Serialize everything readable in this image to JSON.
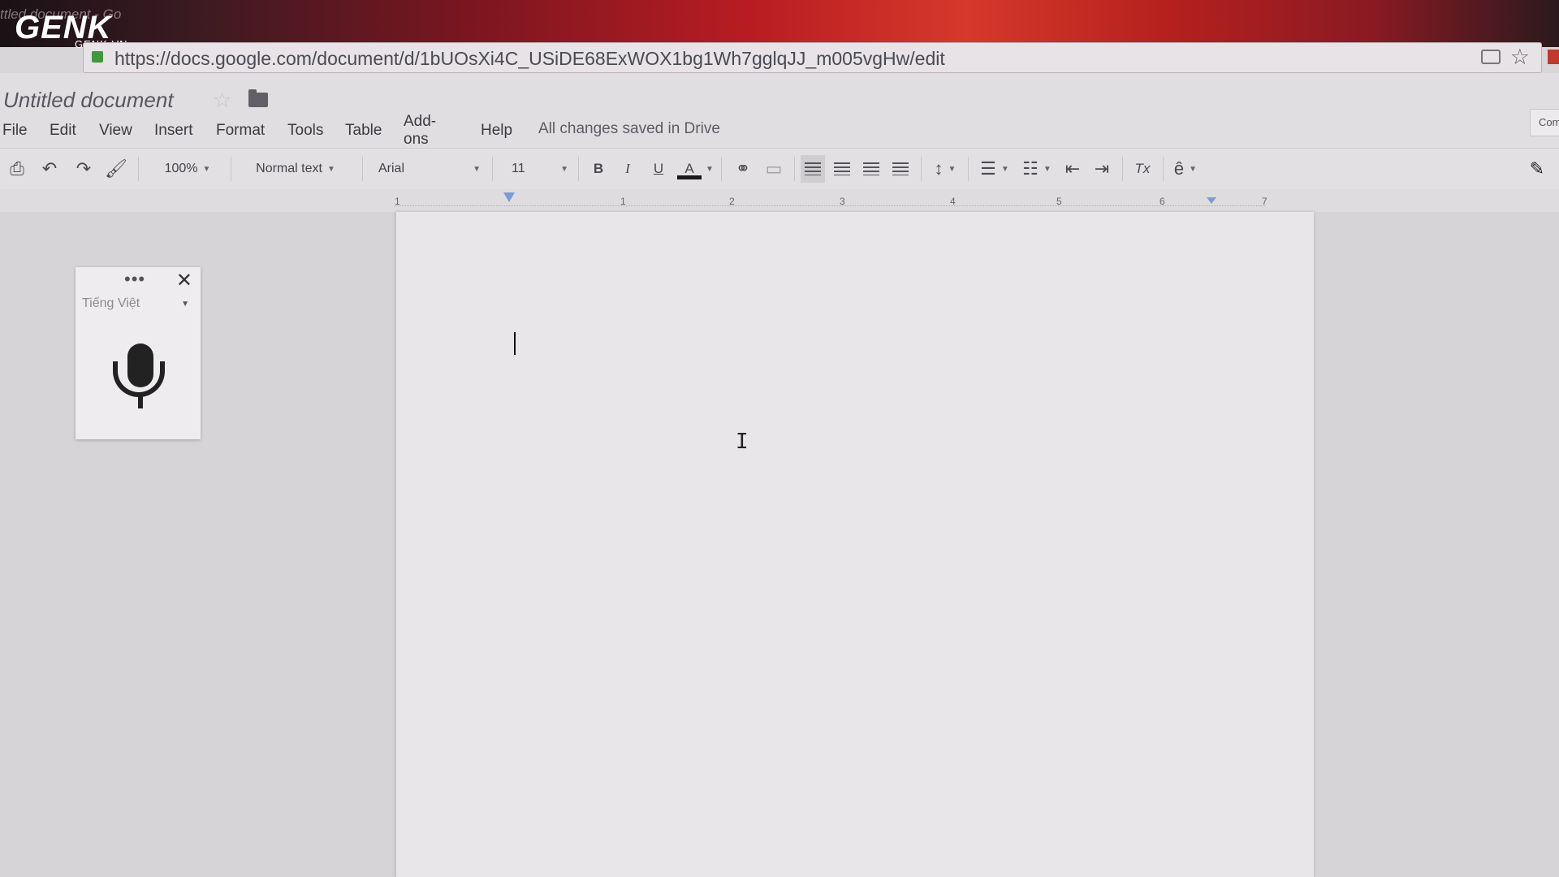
{
  "browser": {
    "tab_title": "ttled document - Go",
    "watermark": "GENK",
    "watermark_sub": "GENK.VN",
    "url": "https://docs.google.com/document/d/1bUOsXi4C_USiDE68ExWOX1bg1Wh7gglqJJ_m005vgHw/edit"
  },
  "doc": {
    "title": "Untitled document",
    "save_status": "All changes saved in Drive",
    "comments_label": "Com"
  },
  "menu": [
    "File",
    "Edit",
    "View",
    "Insert",
    "Format",
    "Tools",
    "Table",
    "Add-ons",
    "Help"
  ],
  "toolbar": {
    "zoom": "100%",
    "style": "Normal text",
    "font": "Arial",
    "size": "11",
    "bold": "B",
    "italic": "I",
    "underline": "U",
    "text_color": "A",
    "clear_format": "Tx",
    "input_tools": "ê"
  },
  "ruler": [
    "1",
    "1",
    "2",
    "3",
    "4",
    "5",
    "6",
    "7"
  ],
  "voice_typing": {
    "dots": "•••",
    "close": "✕",
    "language": "Tiếng Việt"
  },
  "icons": {
    "print": "print-icon",
    "undo": "undo-icon",
    "redo": "redo-icon",
    "paint": "paint-format-icon",
    "link": "link-icon",
    "comment": "comment-icon",
    "microphone": "microphone-icon"
  }
}
